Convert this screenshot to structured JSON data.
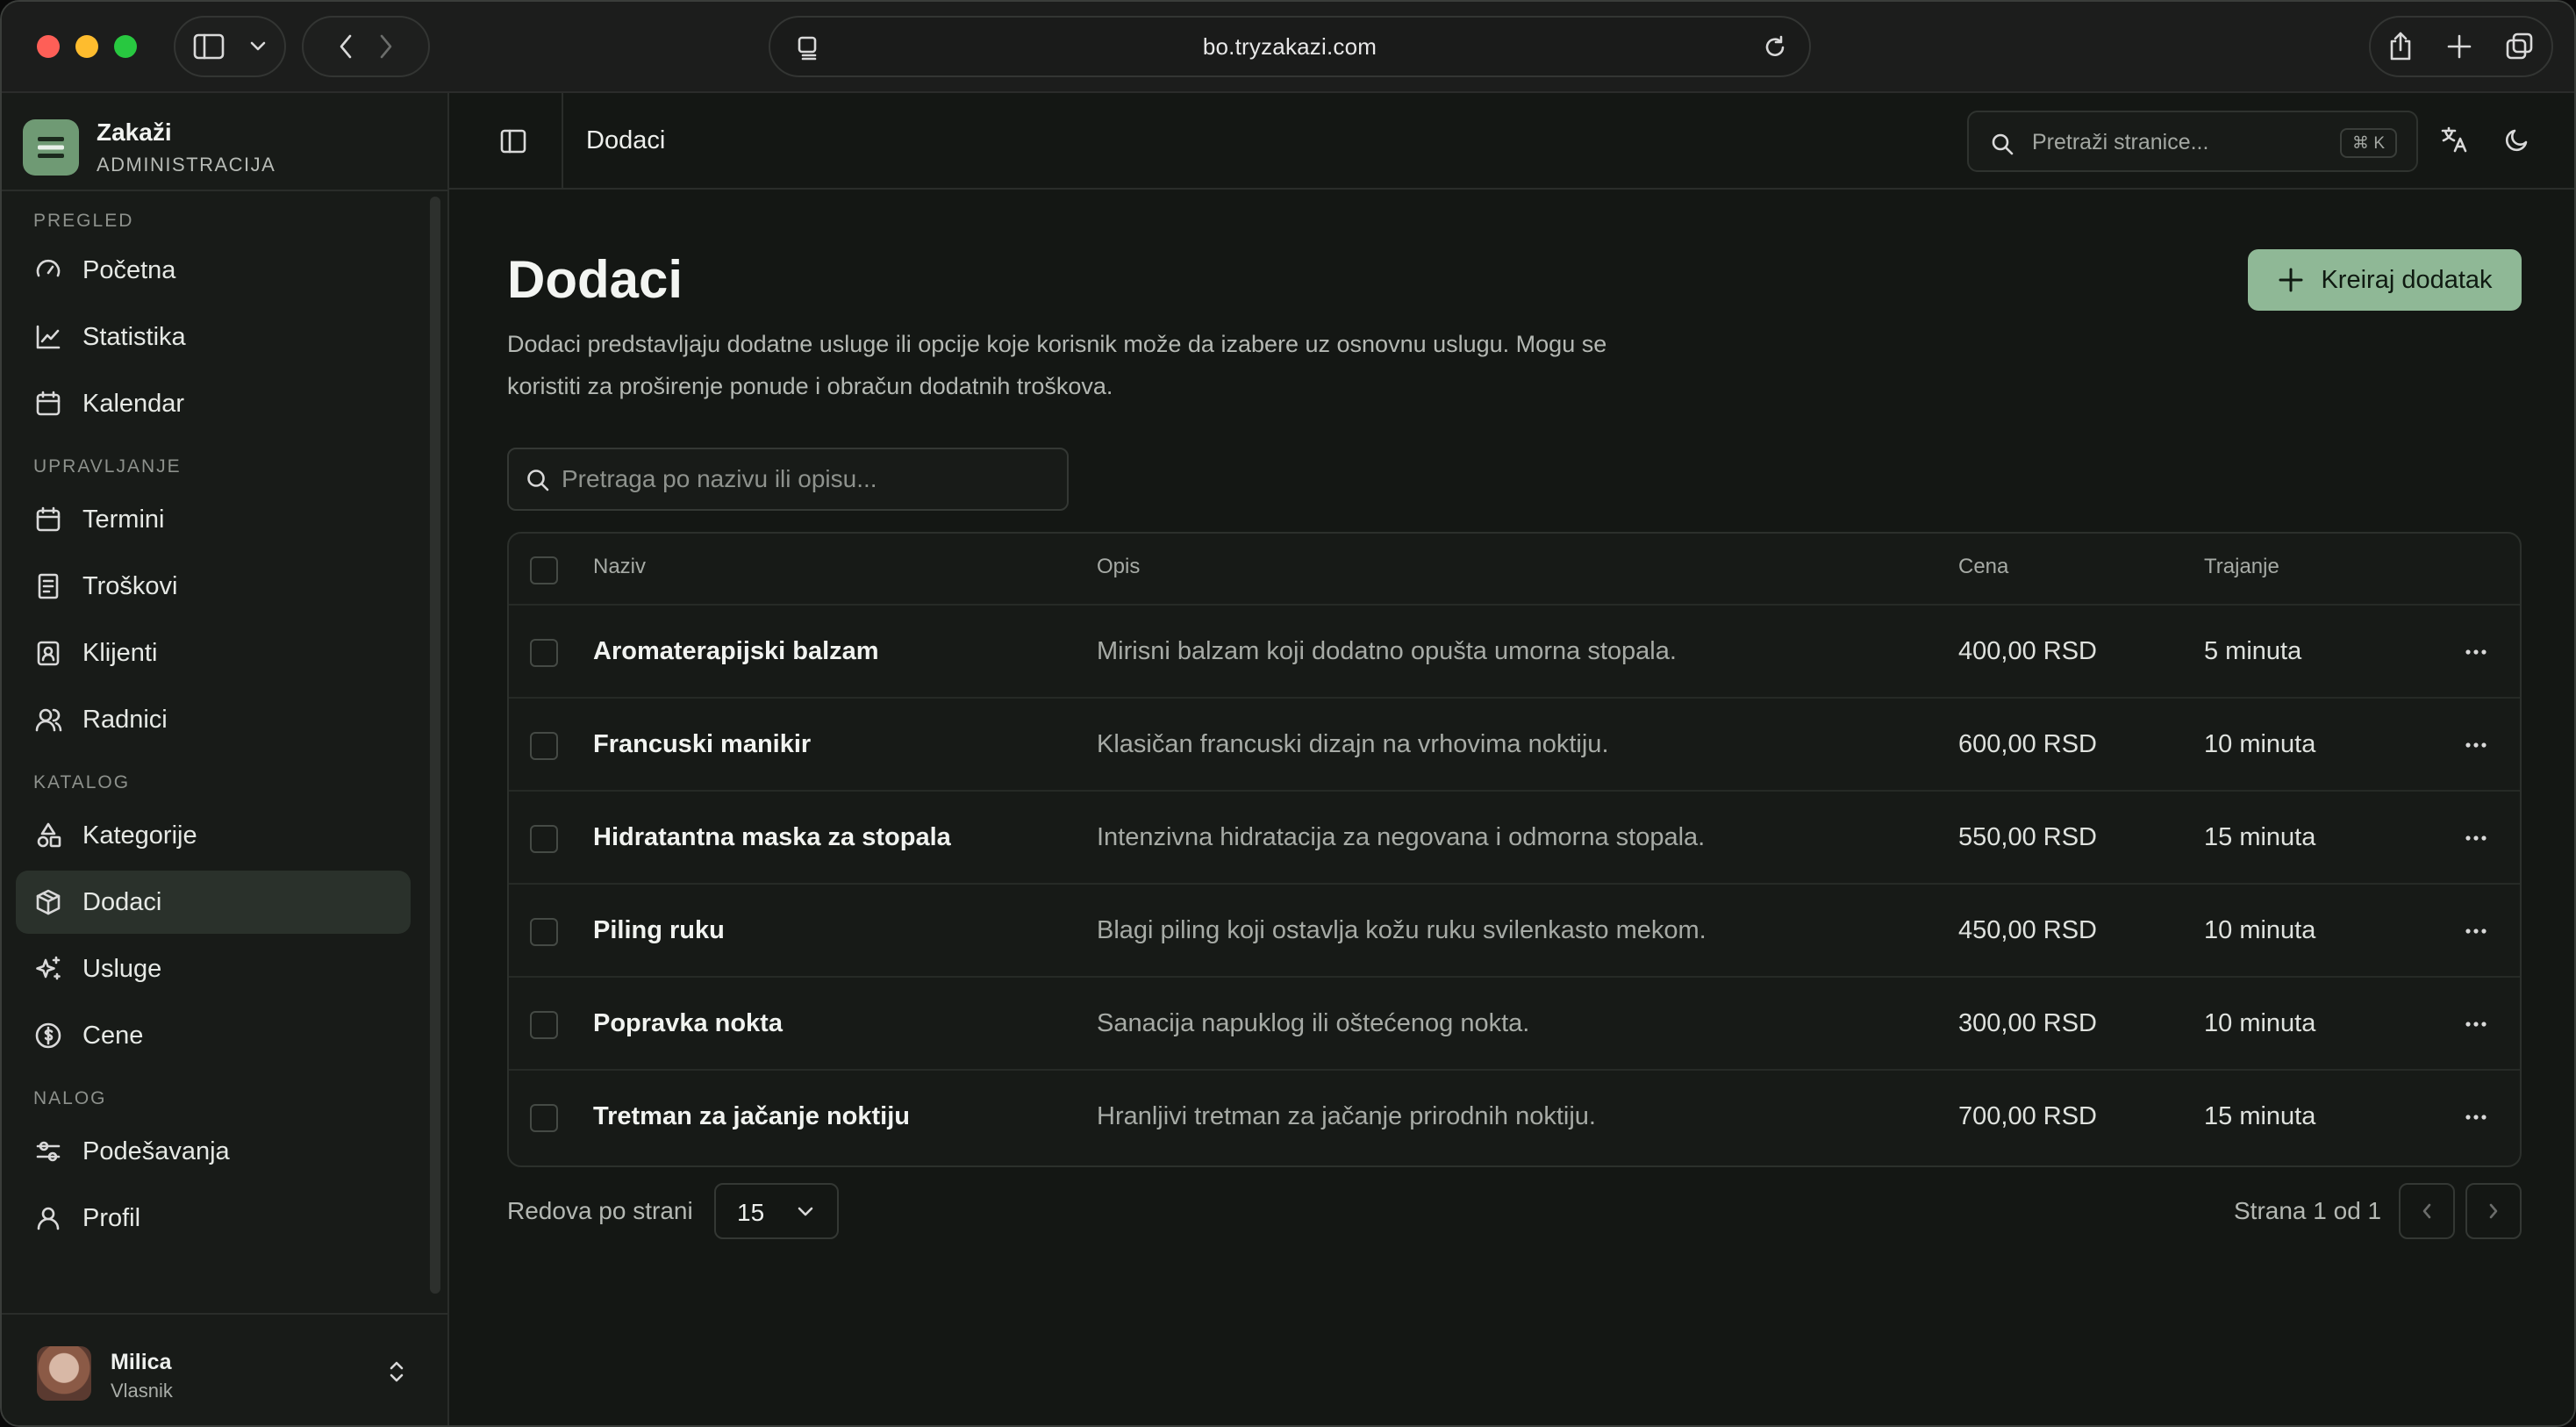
{
  "browser": {
    "url": "bo.tryzakazi.com"
  },
  "brand": {
    "name": "Zakaži",
    "subtitle": "ADMINISTRACIJA"
  },
  "nav": {
    "sections": [
      {
        "title": "PREGLED",
        "items": [
          {
            "label": "Početna",
            "icon": "gauge-icon"
          },
          {
            "label": "Statistika",
            "icon": "chart-icon"
          },
          {
            "label": "Kalendar",
            "icon": "calendar-icon"
          }
        ]
      },
      {
        "title": "UPRAVLJANJE",
        "items": [
          {
            "label": "Termini",
            "icon": "calendar-icon"
          },
          {
            "label": "Troškovi",
            "icon": "receipt-icon"
          },
          {
            "label": "Klijenti",
            "icon": "contact-icon"
          },
          {
            "label": "Radnici",
            "icon": "users-icon"
          }
        ]
      },
      {
        "title": "KATALOG",
        "items": [
          {
            "label": "Kategorije",
            "icon": "shapes-icon"
          },
          {
            "label": "Dodaci",
            "icon": "package-icon",
            "active": true
          },
          {
            "label": "Usluge",
            "icon": "sparkles-icon"
          },
          {
            "label": "Cene",
            "icon": "dollar-icon"
          }
        ]
      },
      {
        "title": "NALOG",
        "items": [
          {
            "label": "Podešavanja",
            "icon": "sliders-icon"
          },
          {
            "label": "Profil",
            "icon": "user-icon"
          }
        ]
      }
    ]
  },
  "user": {
    "name": "Milica",
    "role": "Vlasnik"
  },
  "topbar": {
    "breadcrumb": "Dodaci",
    "search_placeholder": "Pretraži stranice...",
    "shortcut": "⌘ K"
  },
  "page": {
    "title": "Dodaci",
    "description": "Dodaci predstavljaju dodatne usluge ili opcije koje korisnik može da izabere uz osnovnu uslugu. Mogu se koristiti za proširenje ponude i obračun dodatnih troškova.",
    "create_label": "Kreiraj dodatak",
    "filter_placeholder": "Pretraga po nazivu ili opisu..."
  },
  "table": {
    "headers": {
      "name": "Naziv",
      "description": "Opis",
      "price": "Cena",
      "duration": "Trajanje"
    },
    "rows": [
      {
        "name": "Aromaterapijski balzam",
        "description": "Mirisni balzam koji dodatno opušta umorna stopala.",
        "price": "400,00 RSD",
        "duration": "5 minuta"
      },
      {
        "name": "Francuski manikir",
        "description": "Klasičan francuski dizajn na vrhovima noktiju.",
        "price": "600,00 RSD",
        "duration": "10 minuta"
      },
      {
        "name": "Hidratantna maska za stopala",
        "description": "Intenzivna hidratacija za negovana i odmorna stopala.",
        "price": "550,00 RSD",
        "duration": "15 minuta"
      },
      {
        "name": "Piling ruku",
        "description": "Blagi piling koji ostavlja kožu ruku svilenkasto mekom.",
        "price": "450,00 RSD",
        "duration": "10 minuta"
      },
      {
        "name": "Popravka nokta",
        "description": "Sanacija napuklog ili oštećenog nokta.",
        "price": "300,00 RSD",
        "duration": "10 minuta"
      },
      {
        "name": "Tretman za jačanje noktiju",
        "description": "Hranljivi tretman za jačanje prirodnih noktiju.",
        "price": "700,00 RSD",
        "duration": "15 minuta"
      }
    ]
  },
  "pagination": {
    "rows_label": "Redova po strani",
    "rows_value": "15",
    "page_info": "Strana 1 od 1"
  },
  "colors": {
    "accent": "#8fb896",
    "background": "#141714",
    "sidebar": "#181b18",
    "active_item": "#2a312b"
  }
}
